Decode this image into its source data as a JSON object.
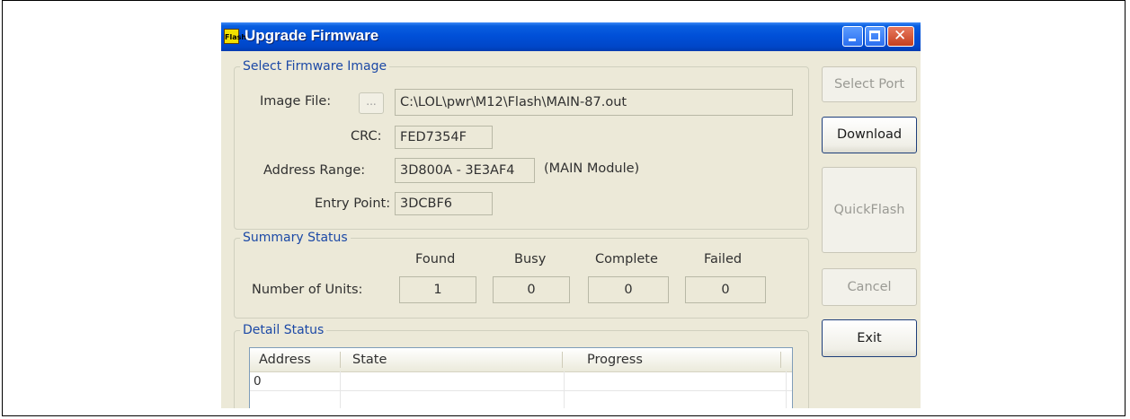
{
  "window": {
    "title": "Upgrade Firmware",
    "app_icon_text": "Flash",
    "close_glyph": "✕"
  },
  "select_firmware_image": {
    "group_label": "Select Firmware Image",
    "image_file_label": "Image File:",
    "browse_label": "...",
    "image_file_value": "C:\\LOL\\pwr\\M12\\Flash\\MAIN-87.out",
    "crc_label": "CRC:",
    "crc_value": "FED7354F",
    "address_range_label": "Address Range:",
    "address_range_value": "3D800A - 3E3AF4",
    "module_note": "(MAIN Module)",
    "entry_point_label": "Entry Point:",
    "entry_point_value": "3DCBF6"
  },
  "summary_status": {
    "group_label": "Summary Status",
    "row_label": "Number of Units:",
    "columns": [
      "Found",
      "Busy",
      "Complete",
      "Failed"
    ],
    "values": [
      "1",
      "0",
      "0",
      "0"
    ]
  },
  "detail_status": {
    "group_label": "Detail Status",
    "columns": [
      "Address",
      "State",
      "Progress"
    ],
    "rows": [
      {
        "address": "0",
        "state": "",
        "progress": ""
      }
    ]
  },
  "buttons": {
    "select_port": "Select Port",
    "download": "Download",
    "quickflash": "QuickFlash",
    "cancel": "Cancel",
    "exit": "Exit"
  }
}
